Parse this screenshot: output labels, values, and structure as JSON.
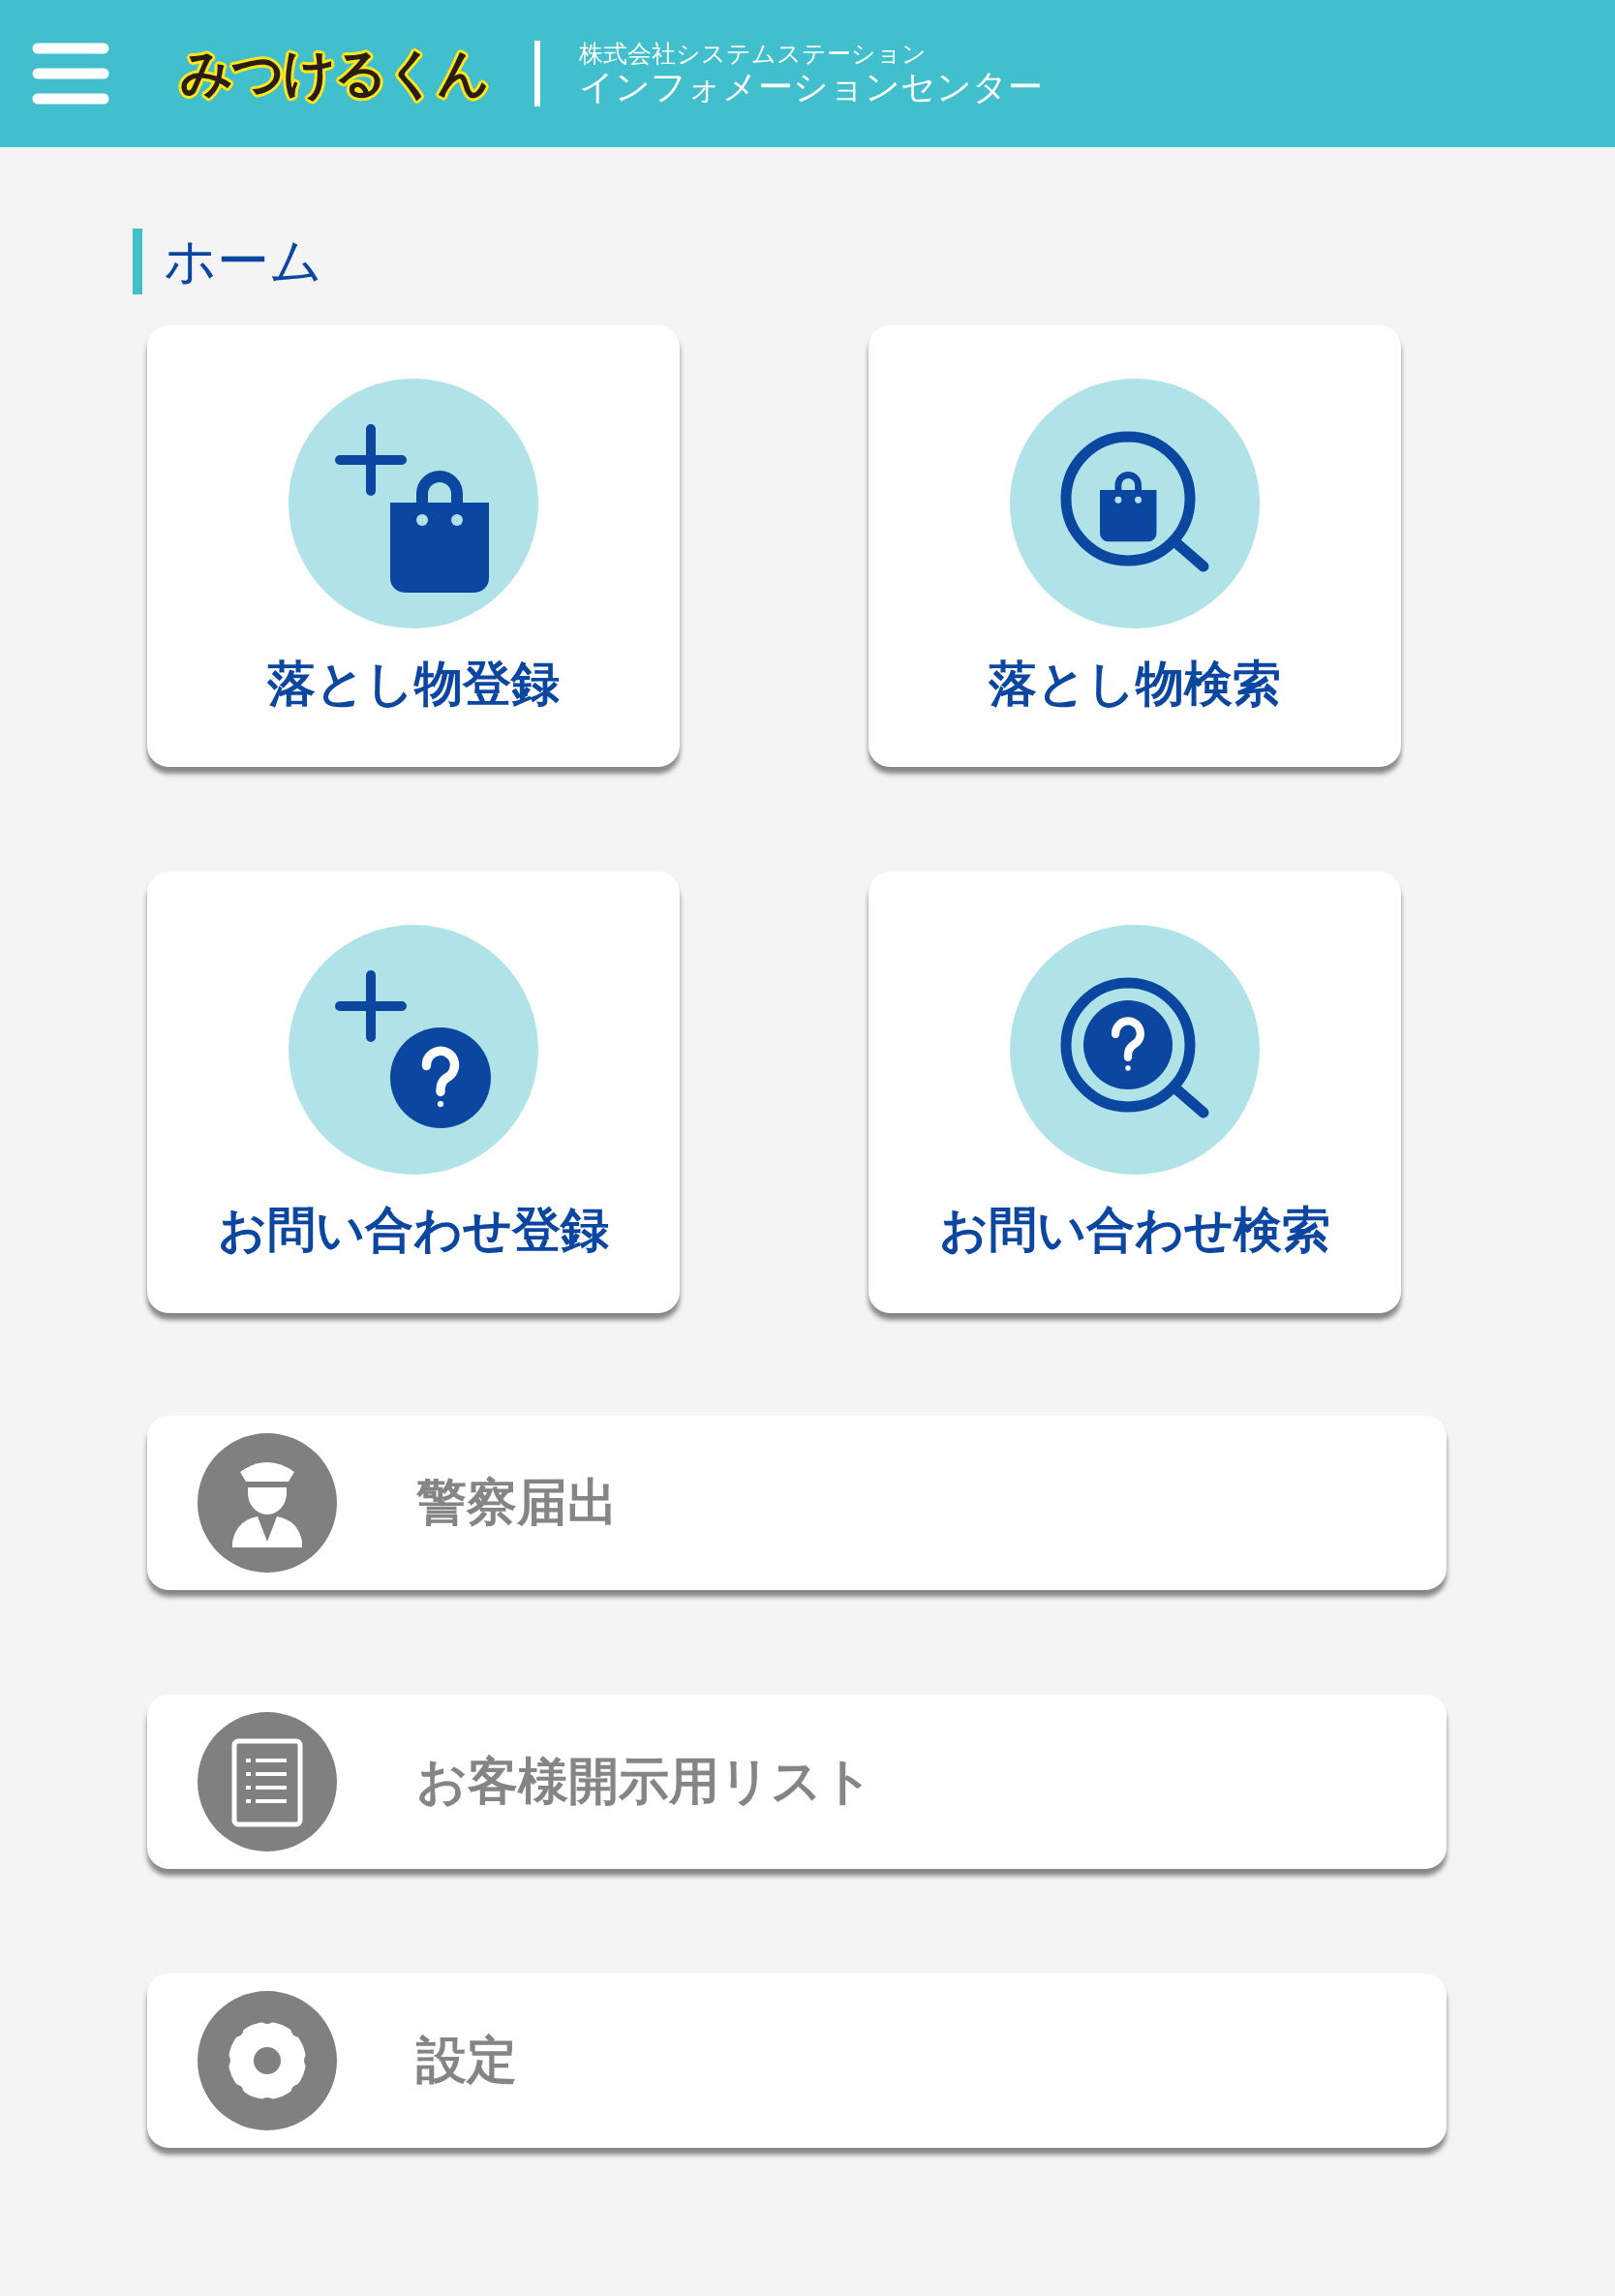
{
  "header": {
    "logo": "みつけるくん",
    "company": "株式会社システムステーション",
    "subtitle": "インフォメーションセンター"
  },
  "page_title": "ホーム",
  "tiles": [
    {
      "label": "落とし物登録",
      "kind": "add-item"
    },
    {
      "label": "落とし物検索",
      "kind": "search-item"
    },
    {
      "label": "お問い合わせ登録",
      "kind": "add-inquiry"
    },
    {
      "label": "お問い合わせ検索",
      "kind": "search-inquiry"
    }
  ],
  "menu_items": [
    {
      "label": "警察届出",
      "kind": "police"
    },
    {
      "label": "お客様開示用リスト",
      "kind": "document"
    },
    {
      "label": "設定",
      "kind": "settings"
    }
  ]
}
